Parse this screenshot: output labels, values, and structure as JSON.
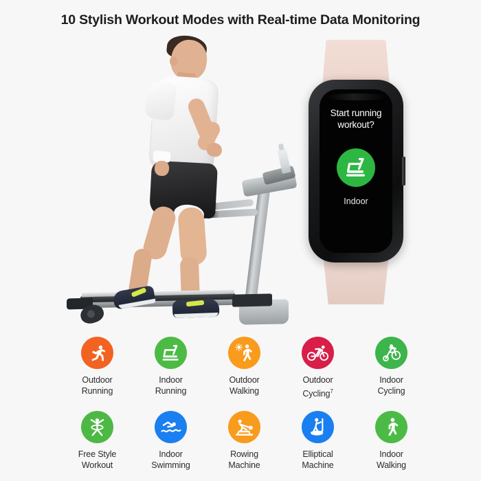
{
  "page": {
    "title": "10 Stylish Workout Modes with Real-time Data Monitoring",
    "background_color": "#f7f7f7",
    "text_color": "#1d1d1d"
  },
  "hero": {
    "scene_name": "man-walking-on-treadmill",
    "person": {
      "shirt_color": "#ffffff",
      "shorts_color": "#242426",
      "shoe_color": "#222838",
      "shoe_accent_color": "#d4e84a",
      "wristband_color": "#fcfcfc"
    },
    "treadmill": {
      "frame_color": "#b9bdbf",
      "belt_color": "#24272a",
      "bottle_color": "#dfe3e5"
    }
  },
  "watch": {
    "band_color": "#ecd5cc",
    "case_color": "#1c1d1f",
    "screen_background": "#030303",
    "question": "Start running workout?",
    "icon_name": "treadmill-icon",
    "icon_circle_color": "#2db742",
    "icon_color": "#ffffff",
    "subtitle": "Indoor",
    "side_button_name": "watch-side-button"
  },
  "modes": {
    "rows": [
      [
        {
          "label": "Outdoor\nRunning",
          "icon": "running-person-icon",
          "color": "#f26322",
          "superscript": ""
        },
        {
          "label": "Indoor\nRunning",
          "icon": "treadmill-icon",
          "color": "#4cbb45",
          "superscript": ""
        },
        {
          "label": "Outdoor\nWalking",
          "icon": "walking-person-sun-icon",
          "color": "#f99b1c",
          "superscript": ""
        },
        {
          "label": "Outdoor\nCycling",
          "icon": "road-cyclist-icon",
          "color": "#d81e49",
          "superscript": "7"
        },
        {
          "label": "Indoor\nCycling",
          "icon": "spin-bike-icon",
          "color": "#3cb54a",
          "superscript": ""
        }
      ],
      [
        {
          "label": "Free Style\nWorkout",
          "icon": "free-style-workout-icon",
          "color": "#4cb944",
          "superscript": ""
        },
        {
          "label": "Indoor\nSwimming",
          "icon": "swimmer-icon",
          "color": "#1a7ff0",
          "superscript": ""
        },
        {
          "label": "Rowing\nMachine",
          "icon": "rowing-machine-icon",
          "color": "#f99b1c",
          "superscript": ""
        },
        {
          "label": "Elliptical\nMachine",
          "icon": "elliptical-machine-icon",
          "color": "#1a7ff0",
          "superscript": ""
        },
        {
          "label": "Indoor\nWalking",
          "icon": "walking-person-icon",
          "color": "#4cbb45",
          "superscript": ""
        }
      ]
    ]
  }
}
